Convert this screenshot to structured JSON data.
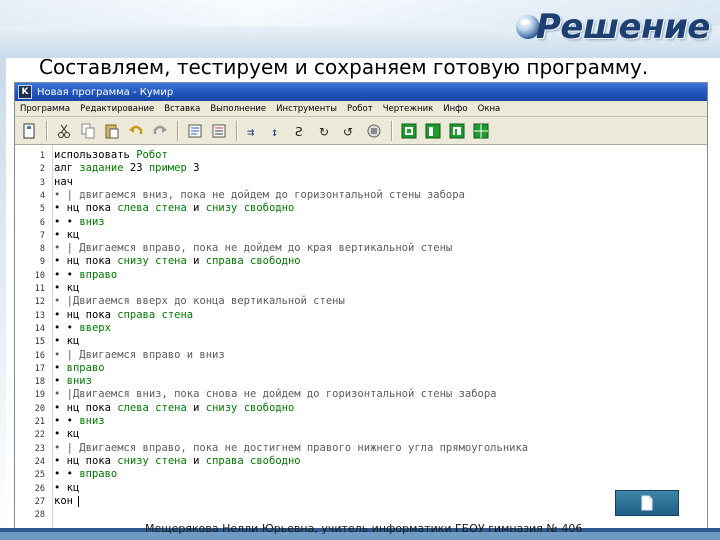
{
  "slide": {
    "title": "Решение",
    "subtitle": "Составляем, тестируем и сохраняем готовую программу.",
    "footer": "Мещерякова Нелли Юрьевна, учитель информатики ГБОУ гимназия № 406"
  },
  "window": {
    "title": "Новая программа - Кумир",
    "app_icon_letter": "K"
  },
  "menu": [
    "Программа",
    "Редактирование",
    "Вставка",
    "Выполнение",
    "Инструменты",
    "Робот",
    "Чертежник",
    "Инфо",
    "Окна"
  ],
  "toolbar": [
    "new-file-icon",
    "cut-icon",
    "copy-icon",
    "paste-icon",
    "undo-icon",
    "redo-icon",
    "field-icon",
    "align-icon",
    "run-icon",
    "step-icon",
    "step-into-icon",
    "step-out-icon",
    "stop-icon",
    "reset-icon",
    "robot-field-icon",
    "robot-window-icon",
    "draw-window-icon",
    "grid-icon"
  ],
  "code": [
    {
      "n": "1",
      "text": "использовать Робот"
    },
    {
      "n": "2",
      "text": "алг задание 23 пример 3"
    },
    {
      "n": "3",
      "text": "нач"
    },
    {
      "n": "4",
      "text": "• | двигаемся вниз, пока не дойдем до горизонтальной стены забора"
    },
    {
      "n": "5",
      "text": "• нц пока слева стена и снизу свободно"
    },
    {
      "n": "6",
      "text": "• • вниз"
    },
    {
      "n": "7",
      "text": "• кц"
    },
    {
      "n": "8",
      "text": "• | Двигаемся вправо, пока не дойдем до края вертикальной стены"
    },
    {
      "n": "9",
      "text": "• нц пока снизу стена и справа свободно"
    },
    {
      "n": "10",
      "text": "• • вправо"
    },
    {
      "n": "11",
      "text": "• кц"
    },
    {
      "n": "12",
      "text": "• |Двигаемся вверх до конца вертикальной стены"
    },
    {
      "n": "13",
      "text": "• нц пока справа стена"
    },
    {
      "n": "14",
      "text": "• • вверх"
    },
    {
      "n": "15",
      "text": "• кц"
    },
    {
      "n": "16",
      "text": "• | Двигаемся вправо и вниз"
    },
    {
      "n": "17",
      "text": "• вправо"
    },
    {
      "n": "18",
      "text": "• вниз"
    },
    {
      "n": "19",
      "text": "• |Двигаемся вниз, пока снова не дойдем до горизонтальной стены забора"
    },
    {
      "n": "20",
      "text": "• нц пока слева стена и снизу свободно"
    },
    {
      "n": "21",
      "text": "• • вниз"
    },
    {
      "n": "22",
      "text": "• кц"
    },
    {
      "n": "23",
      "text": "• | Двигаемся вправо, пока не достигнем правого нижнего угла прямоугольника"
    },
    {
      "n": "24",
      "text": "• нц пока снизу стена и справа свободно"
    },
    {
      "n": "25",
      "text": "• • вправо"
    },
    {
      "n": "26",
      "text": "• кц"
    },
    {
      "n": "27",
      "text": "кон"
    },
    {
      "n": "28",
      "text": ""
    }
  ],
  "colors": {
    "title": "#1d3f72",
    "window_title_bar": "#1f55be",
    "identifier": "#007a00",
    "nav_button": "#2a6f96"
  }
}
